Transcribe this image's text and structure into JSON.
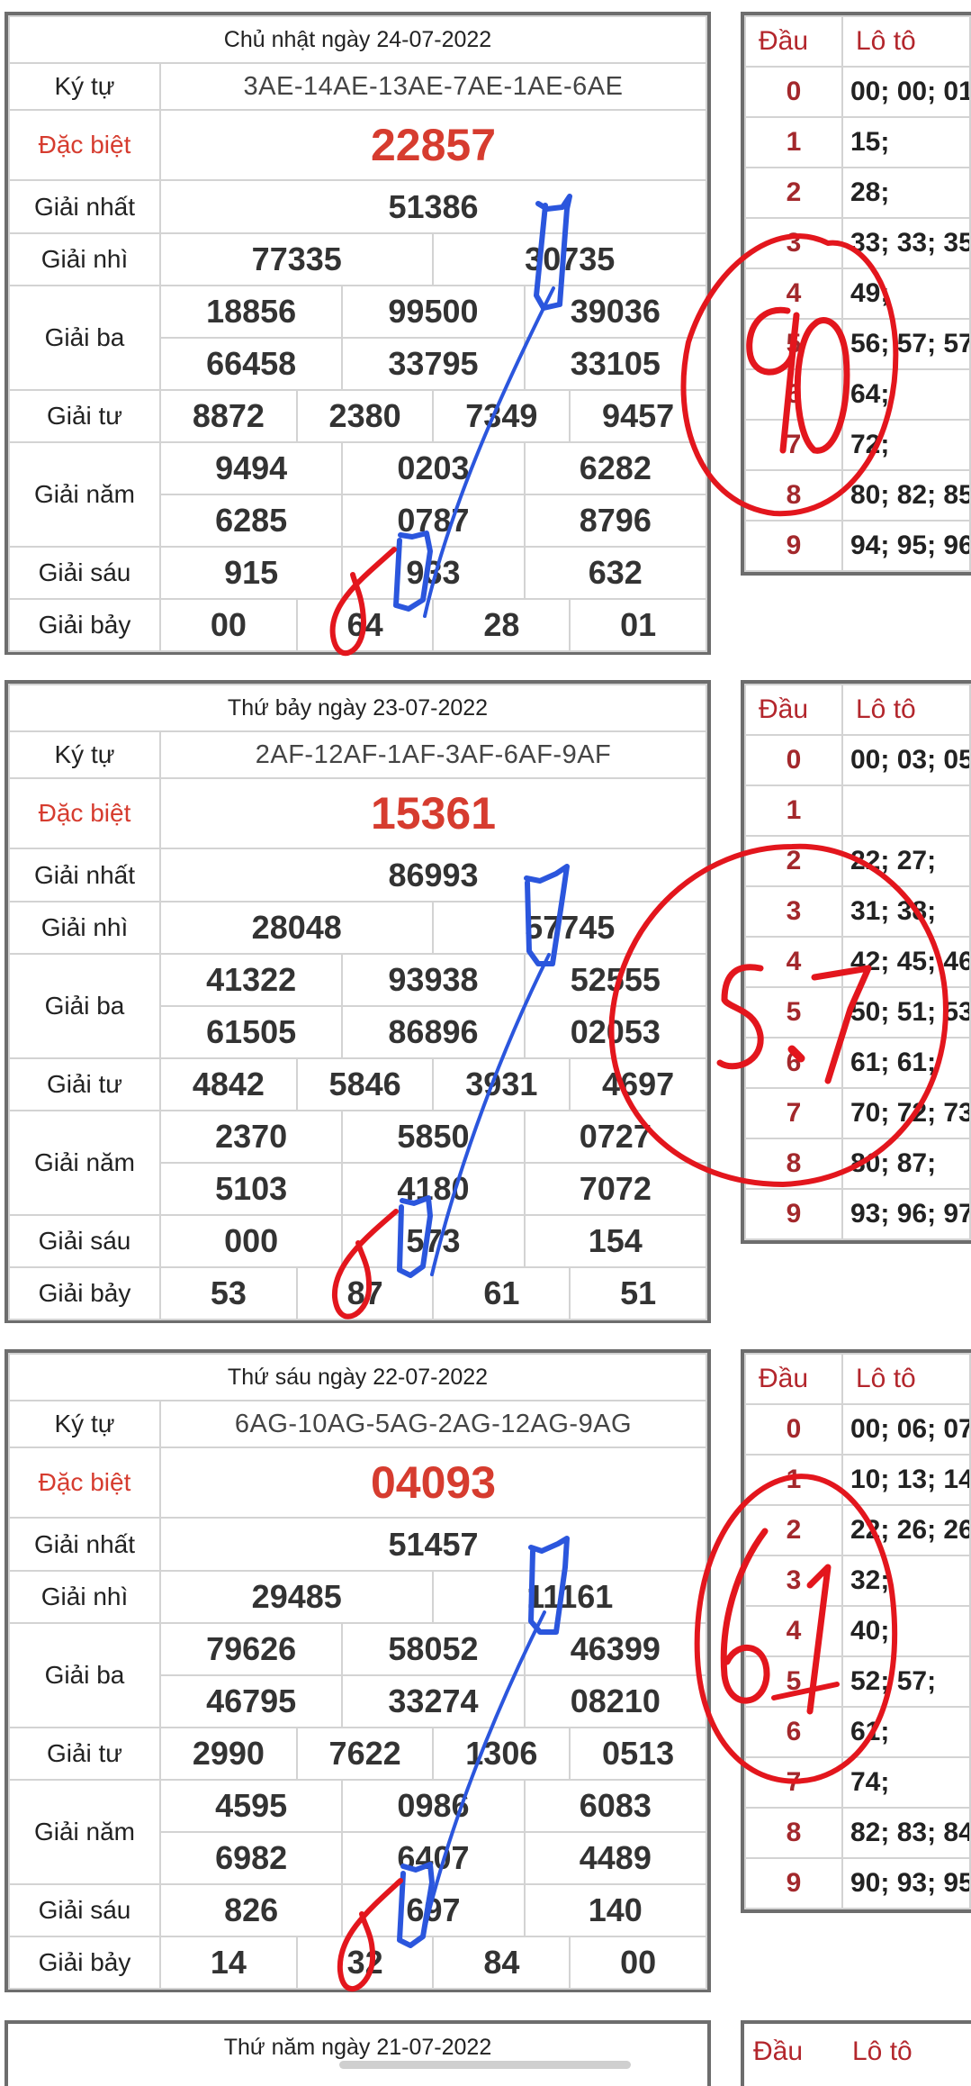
{
  "days": [
    {
      "date": "Chủ nhật ngày 24-07-2022",
      "kytu": "3AE-14AE-13AE-7AE-1AE-6AE",
      "dacbiet": "22857",
      "nhat": "51386",
      "nhi": [
        "77335",
        "30735"
      ],
      "ba": [
        "18856",
        "99500",
        "39036",
        "66458",
        "33795",
        "33105"
      ],
      "tu": [
        "8872",
        "2380",
        "7349",
        "9457"
      ],
      "nam": [
        "9494",
        "0203",
        "6282",
        "6285",
        "0787",
        "8796"
      ],
      "sau": [
        "915",
        "933",
        "632"
      ],
      "bay": [
        "00",
        "64",
        "28",
        "01"
      ],
      "loto": [
        "00; 00; 01",
        "15;",
        "28;",
        "33; 33; 35",
        "49;",
        "56; 57; 57",
        "64;",
        "72;",
        "80; 82; 85",
        "94; 95; 96"
      ],
      "annotation": "90"
    },
    {
      "date": "Thứ bảy ngày 23-07-2022",
      "kytu": "2AF-12AF-1AF-3AF-6AF-9AF",
      "dacbiet": "15361",
      "nhat": "86993",
      "nhi": [
        "28048",
        "57745"
      ],
      "ba": [
        "41322",
        "93938",
        "52555",
        "61505",
        "86896",
        "02053"
      ],
      "tu": [
        "4842",
        "5846",
        "3931",
        "4697"
      ],
      "nam": [
        "2370",
        "5850",
        "0727",
        "5103",
        "4180",
        "7072"
      ],
      "sau": [
        "000",
        "573",
        "154"
      ],
      "bay": [
        "53",
        "87",
        "61",
        "51"
      ],
      "loto": [
        "00; 03; 05",
        "",
        "22; 27;",
        "31; 38;",
        "42; 45; 46",
        "50; 51; 53",
        "61; 61;",
        "70; 72; 73",
        "80; 87;",
        "93; 96; 97"
      ],
      "annotation": "57"
    },
    {
      "date": "Thứ sáu ngày 22-07-2022",
      "kytu": "6AG-10AG-5AG-2AG-12AG-9AG",
      "dacbiet": "04093",
      "nhat": "51457",
      "nhi": [
        "29485",
        "11161"
      ],
      "ba": [
        "79626",
        "58052",
        "46399",
        "46795",
        "33274",
        "08210"
      ],
      "tu": [
        "2990",
        "7622",
        "1306",
        "0513"
      ],
      "nam": [
        "4595",
        "0986",
        "6083",
        "6982",
        "6407",
        "4489"
      ],
      "sau": [
        "826",
        "697",
        "140"
      ],
      "bay": [
        "14",
        "32",
        "84",
        "00"
      ],
      "loto": [
        "00; 06; 07",
        "10; 13; 14",
        "22; 26; 26",
        "32;",
        "40;",
        "52; 57;",
        "61;",
        "74;",
        "82; 83; 84",
        "90; 93; 95"
      ],
      "annotation": "61"
    }
  ],
  "next_day_partial": "Thứ năm ngày 21-07-2022",
  "labels": {
    "kytu": "Ký tự",
    "dacbiet": "Đặc biệt",
    "nhat": "Giải nhất",
    "nhi": "Giải nhì",
    "ba": "Giải ba",
    "tu": "Giải tư",
    "nam": "Giải năm",
    "sau": "Giải sáu",
    "bay": "Giải bảy",
    "dau": "Đầu",
    "loto": "Lô tô"
  },
  "colors": {
    "special": "#d63c2f",
    "border": "#6d6d6d",
    "annotation_red": "#e3161d",
    "annotation_blue": "#2b56dd"
  }
}
